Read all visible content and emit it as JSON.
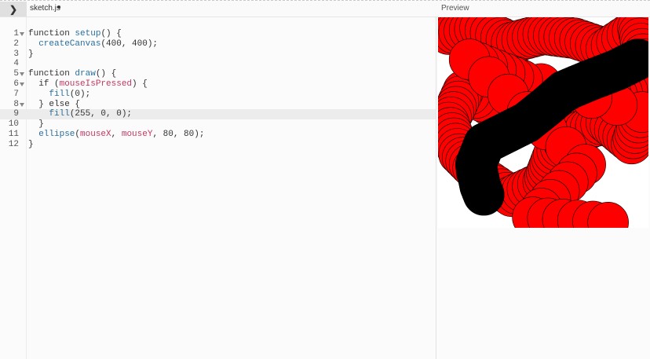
{
  "tab": {
    "filename": "sketch.js",
    "expand_icon": "chevron-right-icon"
  },
  "preview": {
    "label": "Preview"
  },
  "code_lines": [
    {
      "n": "1",
      "fold": true,
      "tokens": [
        [
          "kw",
          "function "
        ],
        [
          "fn",
          "setup"
        ],
        [
          "kw",
          "() {"
        ]
      ]
    },
    {
      "n": "2",
      "fold": false,
      "tokens": [
        [
          "kw",
          "  "
        ],
        [
          "fn",
          "createCanvas"
        ],
        [
          "kw",
          "(400, 400);"
        ]
      ]
    },
    {
      "n": "3",
      "fold": false,
      "tokens": [
        [
          "kw",
          "}"
        ]
      ]
    },
    {
      "n": "4",
      "fold": false,
      "tokens": []
    },
    {
      "n": "5",
      "fold": true,
      "tokens": [
        [
          "kw",
          "function "
        ],
        [
          "fn",
          "draw"
        ],
        [
          "kw",
          "() {"
        ]
      ]
    },
    {
      "n": "6",
      "fold": true,
      "tokens": [
        [
          "kw",
          "  if ("
        ],
        [
          "sys",
          "mouseIsPressed"
        ],
        [
          "kw",
          ") {"
        ]
      ]
    },
    {
      "n": "7",
      "fold": false,
      "tokens": [
        [
          "kw",
          "    "
        ],
        [
          "fn",
          "fill"
        ],
        [
          "kw",
          "(0);"
        ]
      ]
    },
    {
      "n": "8",
      "fold": true,
      "tokens": [
        [
          "kw",
          "  } else {"
        ]
      ]
    },
    {
      "n": "9",
      "fold": false,
      "active": true,
      "tokens": [
        [
          "kw",
          "    "
        ],
        [
          "fn",
          "fill"
        ],
        [
          "kw",
          "(255, 0, 0);"
        ]
      ]
    },
    {
      "n": "10",
      "fold": false,
      "tokens": [
        [
          "kw",
          "  }"
        ]
      ]
    },
    {
      "n": "11",
      "fold": false,
      "tokens": [
        [
          "kw",
          "  "
        ],
        [
          "fn",
          "ellipse"
        ],
        [
          "kw",
          "("
        ],
        [
          "sys",
          "mouseX"
        ],
        [
          "kw",
          ", "
        ],
        [
          "sys",
          "mouseY"
        ],
        [
          "kw",
          ", 80, 80);"
        ]
      ]
    },
    {
      "n": "12",
      "fold": false,
      "tokens": [
        [
          "kw",
          "}"
        ]
      ]
    }
  ],
  "sketch": {
    "fill_red": "#ff0000",
    "fill_black": "#000000",
    "stroke": "#000000",
    "red_path": [
      [
        0.05,
        0.08
      ],
      [
        0.2,
        0.05
      ],
      [
        0.35,
        0.12
      ],
      [
        0.5,
        0.08
      ],
      [
        0.65,
        0.1
      ],
      [
        0.8,
        0.15
      ],
      [
        0.95,
        0.05
      ],
      [
        0.98,
        0.2
      ],
      [
        0.9,
        0.35
      ],
      [
        0.75,
        0.4
      ],
      [
        0.6,
        0.45
      ],
      [
        0.45,
        0.5
      ],
      [
        0.3,
        0.45
      ],
      [
        0.12,
        0.35
      ],
      [
        0.05,
        0.5
      ],
      [
        0.1,
        0.65
      ],
      [
        0.2,
        0.75
      ],
      [
        0.35,
        0.85
      ],
      [
        0.5,
        0.78
      ],
      [
        0.55,
        0.65
      ],
      [
        0.65,
        0.55
      ],
      [
        0.8,
        0.5
      ],
      [
        0.92,
        0.6
      ],
      [
        0.97,
        0.45
      ],
      [
        0.25,
        0.25
      ],
      [
        0.4,
        0.3
      ],
      [
        0.15,
        0.2
      ],
      [
        0.7,
        0.7
      ],
      [
        0.45,
        0.95
      ],
      [
        0.88,
        0.98
      ]
    ],
    "black_path": [
      [
        0.95,
        0.2
      ],
      [
        0.85,
        0.25
      ],
      [
        0.72,
        0.3
      ],
      [
        0.6,
        0.35
      ],
      [
        0.52,
        0.42
      ],
      [
        0.42,
        0.5
      ],
      [
        0.32,
        0.55
      ],
      [
        0.22,
        0.6
      ],
      [
        0.18,
        0.7
      ],
      [
        0.2,
        0.8
      ],
      [
        0.22,
        0.85
      ]
    ]
  }
}
